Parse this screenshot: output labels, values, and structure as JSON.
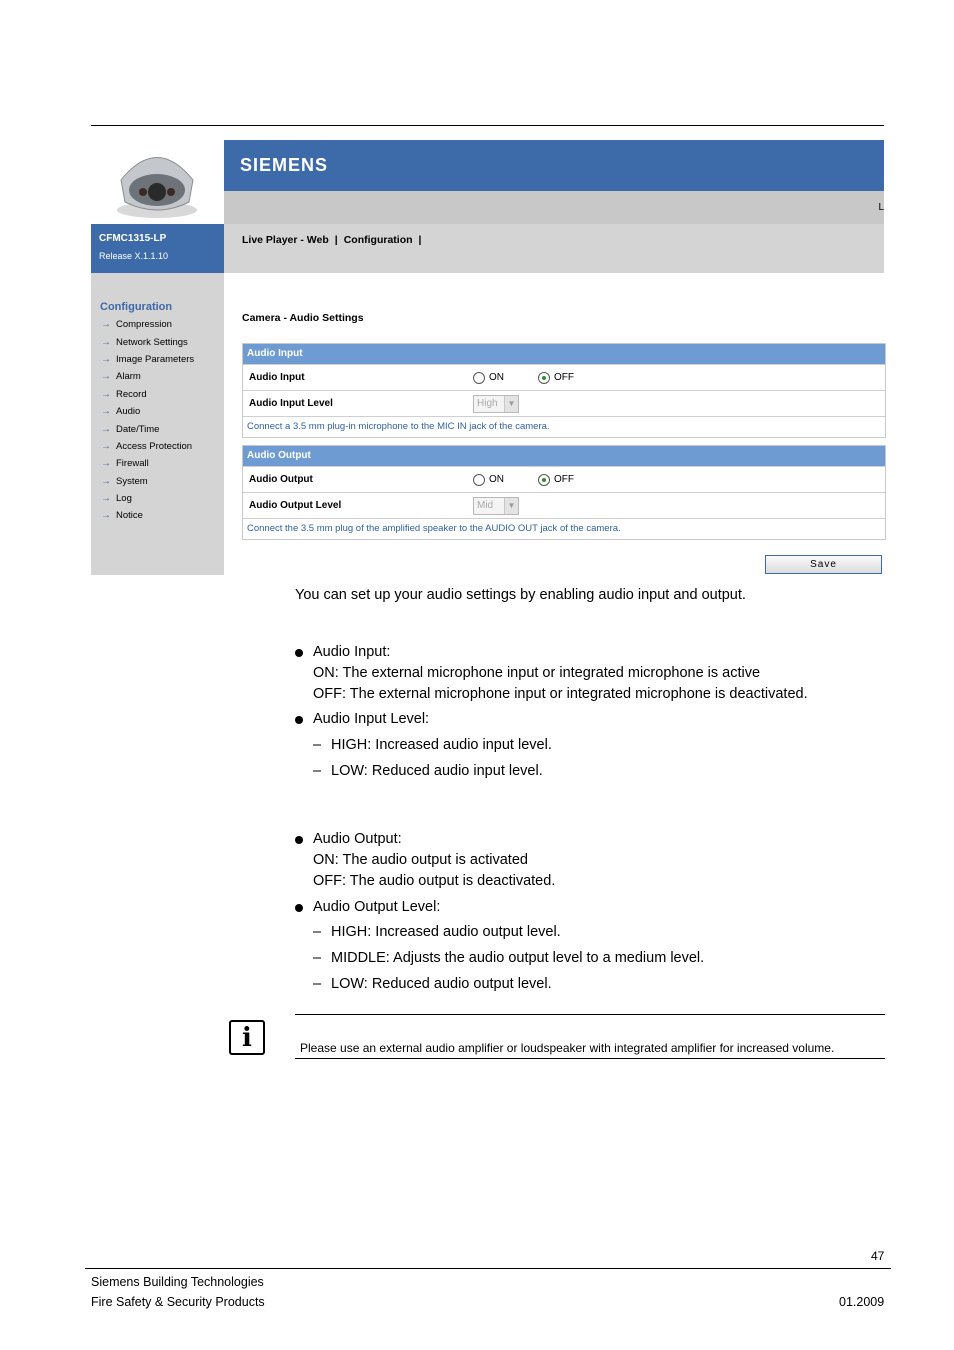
{
  "ui": {
    "brand": "SIEMENS",
    "strip_char": "L",
    "model_name": "CFMC1315-LP",
    "release": "Release X.1.1.10",
    "nav_links": [
      "Live Player - Web",
      "|",
      "Configuration",
      "|"
    ],
    "sidebar": {
      "title": "Configuration",
      "items": [
        "Compression",
        "Network Settings",
        "Image Parameters",
        "Alarm",
        "Record",
        "Audio",
        "Date/Time",
        "Access Protection",
        "Firewall",
        "System",
        "Log",
        "Notice"
      ]
    },
    "page_title": "Camera - Audio Settings",
    "audio_input": {
      "header": "Audio Input",
      "row1_label": "Audio Input",
      "on_label": "ON",
      "off_label": "OFF",
      "selected": "OFF",
      "row2_label": "Audio Input Level",
      "level_value": "High",
      "note": "Connect a 3.5 mm plug-in microphone to the MIC IN jack of the camera."
    },
    "audio_output": {
      "header": "Audio Output",
      "row1_label": "Audio Output",
      "on_label": "ON",
      "off_label": "OFF",
      "selected": "OFF",
      "row2_label": "Audio Output Level",
      "level_value": "Mid",
      "note": "Connect the 3.5 mm plug of the amplified speaker to the AUDIO OUT jack of the camera."
    },
    "save_label": "Save"
  },
  "doc": {
    "intro": "You can set up your audio settings by enabling audio input and output.",
    "input": {
      "title": "Audio Input:",
      "on": "ON: The external microphone input or integrated microphone is active",
      "off": "OFF: The external microphone input or integrated microphone is deactivated.",
      "level_title": "Audio Input Level:",
      "levels": [
        "HIGH: Increased audio input level.",
        "LOW: Reduced audio input level."
      ]
    },
    "output": {
      "title": "Audio Output:",
      "on": "ON: The audio output is activated",
      "off": "OFF: The audio output is deactivated.",
      "level_title": "Audio Output Level:",
      "levels": [
        "HIGH: Increased audio output level.",
        "MIDDLE: Adjusts the audio output level to a medium level.",
        "LOW: Reduced audio output level."
      ]
    },
    "dash": "–",
    "info_icon": "i",
    "info_note": "Please use an external audio amplifier or loudspeaker with integrated amplifier for increased volume."
  },
  "footer": {
    "page_number": "47",
    "company": "Siemens Building Technologies",
    "division": "Fire Safety & Security Products",
    "date": "01.2009"
  }
}
